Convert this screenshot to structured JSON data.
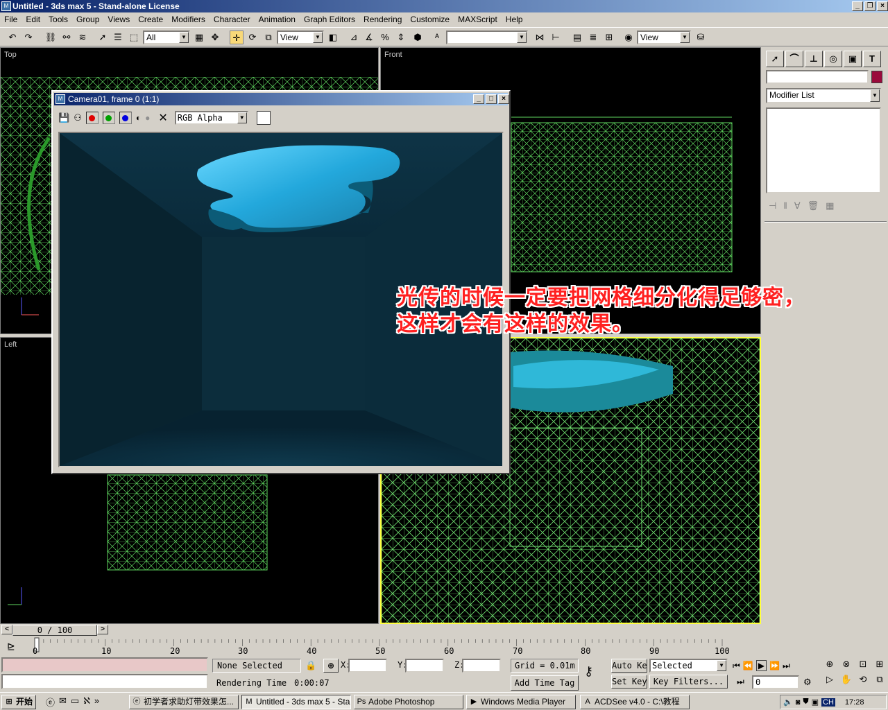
{
  "app": {
    "title": "Untitled - 3ds max 5 - Stand-alone License",
    "icon": "3ds-max-icon"
  },
  "menu": [
    "File",
    "Edit",
    "Tools",
    "Group",
    "Views",
    "Create",
    "Modifiers",
    "Character",
    "Animation",
    "Graph Editors",
    "Rendering",
    "Customize",
    "MAXScript",
    "Help"
  ],
  "toolbar": {
    "selection_filter": "All",
    "ref_coord": "View",
    "named_selection": "",
    "render_view": "View"
  },
  "viewports": {
    "top": "Top",
    "front": "Front",
    "left": "Left"
  },
  "command_panel": {
    "name_value": "",
    "color": "#9a0a3c",
    "modifier_list": "Modifier List"
  },
  "render_window": {
    "title": "Camera01, frame 0 (1:1)",
    "channel": "RGB Alpha"
  },
  "annotation": {
    "line1": "光传的时候一定要把网格细分化得足够密，",
    "line2": "这样才会有这样的效果。"
  },
  "timeline": {
    "slider": "0 / 100",
    "ticks": [
      "0",
      "10",
      "20",
      "30",
      "40",
      "50",
      "60",
      "70",
      "80",
      "90",
      "100"
    ]
  },
  "status": {
    "selection": "None Selected",
    "rendering_time_label": "Rendering Time",
    "rendering_time": "0:00:07",
    "x_label": "X:",
    "y_label": "Y:",
    "z_label": "Z:",
    "grid": "Grid = 0.01m",
    "add_time_tag": "Add Time Tag",
    "auto_key": "Auto Key",
    "set_key": "Set Key",
    "key_mode": "Selected",
    "key_filters": "Key Filters...",
    "frame": "0"
  },
  "taskbar": {
    "start": "开始",
    "tasks": [
      "初学者求助灯带效果怎...",
      "Untitled - 3ds max 5 - Sta...",
      "Adobe Photoshop",
      "Windows Media Player",
      "ACDSee v4.0 - C:\\教程"
    ],
    "lang": "CH",
    "clock": "17:28"
  },
  "colors": {
    "wire": "#5fd85f",
    "render_bg": "#0b2a38",
    "light": "#3cc8f0",
    "annotation": "#ff2020"
  }
}
